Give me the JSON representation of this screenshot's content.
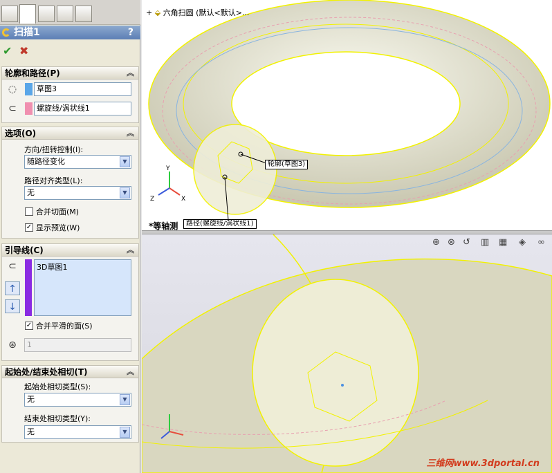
{
  "property_manager": {
    "tabs": [
      "feature-manager-icon",
      "property-manager-icon",
      "configuration-icon",
      "dimxpert-icon",
      "display-icon"
    ],
    "title": "扫描1",
    "help": "?",
    "ok": "✔",
    "cancel": "✖",
    "profile_path": {
      "header": "轮廓和路径(P)",
      "profile_value": "草图3",
      "path_value": "螺旋线/涡状线1",
      "profile_color": "#5aa6e8",
      "path_color": "#f08fb0"
    },
    "options": {
      "header": "选项(O)",
      "orient_label": "方向/扭转控制(I):",
      "orient_value": "随路径变化",
      "align_label": "路径对齐类型(L):",
      "align_value": "无",
      "merge_faces_label": "合并切面(M)",
      "merge_faces_checked": false,
      "show_preview_label": "显示预览(W)",
      "show_preview_checked": true
    },
    "guides": {
      "header": "引导线(C)",
      "list_items": [
        "3D草图1"
      ],
      "merge_smooth_label": "合并平滑的面(S)",
      "merge_smooth_checked": true,
      "spinner_value": "1",
      "bar_color": "#8a2be2"
    },
    "tangency": {
      "header": "起始处/结束处相切(T)",
      "start_label": "起始处相切类型(S):",
      "start_value": "无",
      "end_label": "结束处相切类型(Y):",
      "end_value": "无"
    }
  },
  "viewport": {
    "tree_label": "六角扫圆 (默认<默认>...",
    "profile_callout": "轮廓(草图3)",
    "path_callout": "路径(螺旋线/涡状线1)",
    "view_label": "*等轴测",
    "watermark": "三维网www.3dportal.cn",
    "accent": "#f2f200"
  }
}
